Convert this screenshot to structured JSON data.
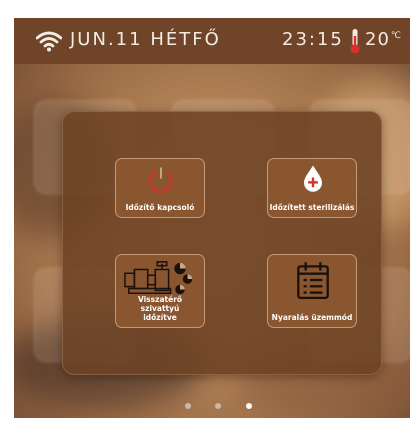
{
  "status_bar": {
    "date": "JUN.11",
    "weekday": "HÉTFŐ",
    "time": "23:15",
    "temperature": "20",
    "temperature_unit": "℃"
  },
  "menu": {
    "tiles": [
      {
        "label": "Időzítő kapcsoló",
        "icon": "power-timer-icon"
      },
      {
        "label": "Időzített sterilizálás",
        "icon": "droplet-plus-icon"
      },
      {
        "label": "Visszatérő szivattyú időzítve",
        "icon": "pump-timer-icon"
      },
      {
        "label": "Nyaralás üzemmód",
        "icon": "calendar-icon"
      }
    ]
  },
  "pagination": {
    "pages": 3,
    "active_page": 3
  },
  "colors": {
    "status_bar": "#6f4428",
    "panel": "#6c4224",
    "tile": "#8a5630",
    "accent_red": "#d9302c"
  }
}
